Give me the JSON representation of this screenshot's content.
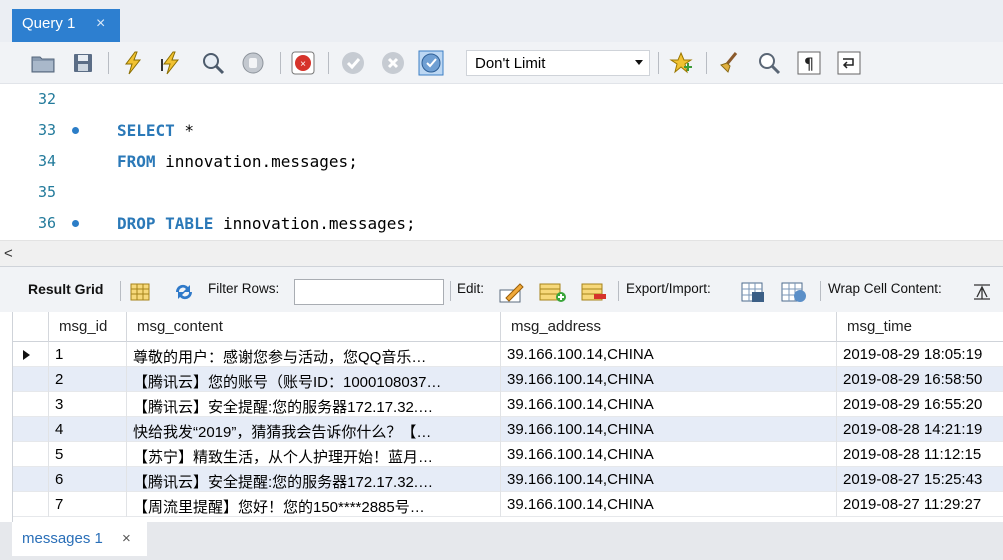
{
  "query_tab": {
    "label": "Query 1",
    "close": "×"
  },
  "toolbar": {
    "limit_value": "Don't Limit",
    "icons": [
      "open-folder-icon",
      "save-icon",
      "execute-icon",
      "execute-current-icon",
      "explain-icon",
      "stop-icon",
      "toggle-error-icon",
      "commit-icon",
      "rollback-icon",
      "autocommit-icon",
      "bookmark-star-icon",
      "beautify-icon",
      "find-icon",
      "invisible-chars-icon",
      "word-wrap-icon"
    ]
  },
  "editor": {
    "lines": [
      {
        "num": "32",
        "dot": false,
        "kw1": "",
        "rest1": "",
        "kw2": "",
        "rest2": ""
      },
      {
        "num": "33",
        "dot": true,
        "kw1": "SELECT",
        "rest1": " *",
        "kw2": "",
        "rest2": ""
      },
      {
        "num": "34",
        "dot": false,
        "kw1": "FROM",
        "rest1": " innovation.messages;",
        "kw2": "",
        "rest2": ""
      },
      {
        "num": "35",
        "dot": false,
        "kw1": "",
        "rest1": "",
        "kw2": "",
        "rest2": ""
      },
      {
        "num": "36",
        "dot": true,
        "kw1": "DROP TABLE",
        "rest1": " innovation.messages;",
        "kw2": "",
        "rest2": ""
      }
    ],
    "scroll_left": "<"
  },
  "result_toolbar": {
    "result_grid": "Result Grid",
    "filter_rows": "Filter Rows:",
    "edit": "Edit:",
    "export_import": "Export/Import:",
    "wrap_cell": "Wrap Cell Content:"
  },
  "grid": {
    "columns": [
      "msg_id",
      "msg_content",
      "msg_address",
      "msg_time"
    ],
    "rows": [
      {
        "id": "1",
        "content": "尊敬的用户：感谢您参与活动，您QQ音乐…",
        "address": "39.166.100.14,CHINA",
        "time": "2019-08-29 18:05:19"
      },
      {
        "id": "2",
        "content": "【腾讯云】您的账号（账号ID：1000108037…",
        "address": "39.166.100.14,CHINA",
        "time": "2019-08-29 16:58:50"
      },
      {
        "id": "3",
        "content": "【腾讯云】安全提醒:您的服务器172.17.32.…",
        "address": "39.166.100.14,CHINA",
        "time": "2019-08-29 16:55:20"
      },
      {
        "id": "4",
        "content": "快给我发“2019”，猜猜我会告诉你什么？【…",
        "address": "39.166.100.14,CHINA",
        "time": "2019-08-28 14:21:19"
      },
      {
        "id": "5",
        "content": "【苏宁】精致生活，从个人护理开始！蓝月…",
        "address": "39.166.100.14,CHINA",
        "time": "2019-08-28 11:12:15"
      },
      {
        "id": "6",
        "content": "【腾讯云】安全提醒:您的服务器172.17.32.…",
        "address": "39.166.100.14,CHINA",
        "time": "2019-08-27 15:25:43"
      },
      {
        "id": "7",
        "content": "【周流里提醒】您好！您的150****2885号…",
        "address": "39.166.100.14,CHINA",
        "time": "2019-08-27 11:29:27"
      }
    ]
  },
  "bottom_tab": {
    "label": "messages 1",
    "close": "×"
  }
}
